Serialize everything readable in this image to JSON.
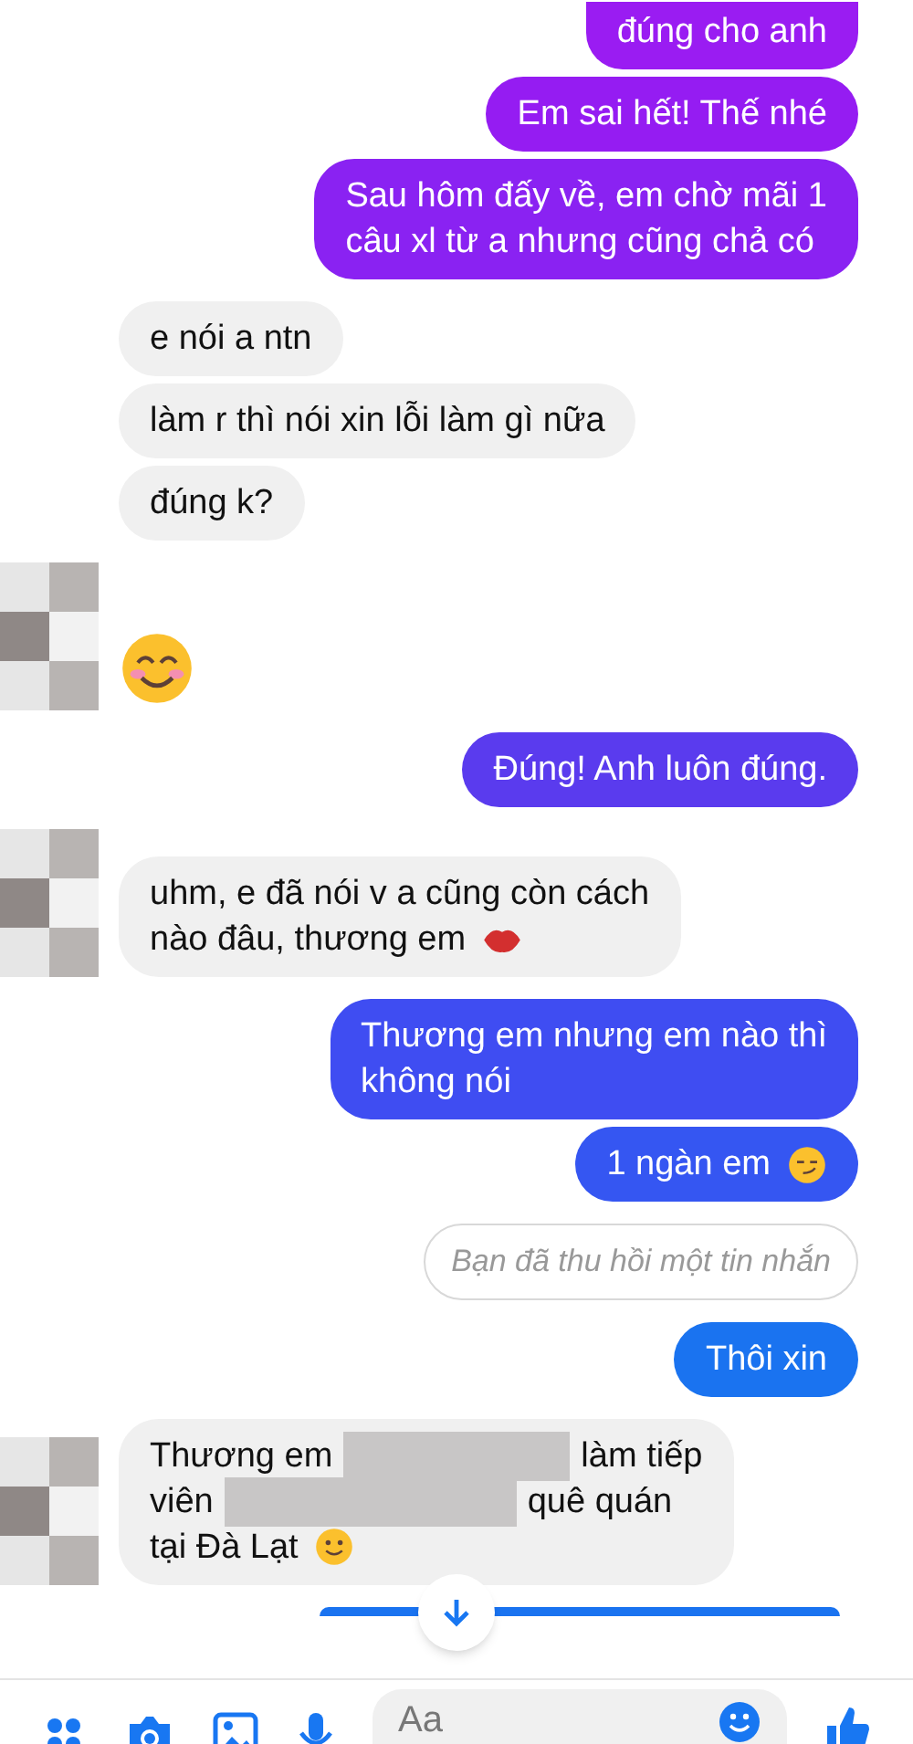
{
  "messages": [
    {
      "kind": "bubble",
      "outgoing": true,
      "color": "#9a1cf2",
      "cut_top": true,
      "avatar": false,
      "lines": [
        [
          {
            "kind": "text",
            "text": "đúng cho anh"
          }
        ]
      ]
    },
    {
      "kind": "bubble",
      "outgoing": true,
      "color": "#951cf2",
      "cut_top": false,
      "avatar": false,
      "lines": [
        [
          {
            "kind": "text",
            "text": "Em sai hết! Thế nhé"
          }
        ]
      ]
    },
    {
      "kind": "bubble",
      "outgoing": true,
      "color": "#8a22f2",
      "cut_top": false,
      "avatar": false,
      "lines": [
        [
          {
            "kind": "text",
            "text": "Sau hôm đấy về, em chờ mãi 1"
          }
        ],
        [
          {
            "kind": "text",
            "text": "câu xl từ a nhưng cũng chả có"
          }
        ]
      ]
    },
    {
      "kind": "bubble",
      "outgoing": false,
      "color": "#f0f0f0",
      "cut_top": false,
      "avatar": false,
      "lines": [
        [
          {
            "kind": "text",
            "text": "e nói a ntn"
          }
        ]
      ]
    },
    {
      "kind": "bubble",
      "outgoing": false,
      "color": "#f0f0f0",
      "cut_top": false,
      "avatar": false,
      "lines": [
        [
          {
            "kind": "text",
            "text": "làm r thì nói xin lỗi làm gì nữa"
          }
        ]
      ]
    },
    {
      "kind": "bubble",
      "outgoing": false,
      "color": "#f0f0f0",
      "cut_top": false,
      "avatar": false,
      "lines": [
        [
          {
            "kind": "text",
            "text": "đúng k?"
          }
        ]
      ]
    },
    {
      "kind": "emoji",
      "outgoing": false,
      "avatar": true,
      "lines": [
        [
          {
            "kind": "blush"
          }
        ]
      ]
    },
    {
      "kind": "bubble",
      "outgoing": true,
      "color": "#5a3bee",
      "cut_top": false,
      "avatar": false,
      "lines": [
        [
          {
            "kind": "text",
            "text": "Đúng! Anh luôn đúng."
          }
        ]
      ]
    },
    {
      "kind": "bubble",
      "outgoing": false,
      "color": "#f0f0f0",
      "cut_top": false,
      "avatar": true,
      "lines": [
        [
          {
            "kind": "text",
            "text": "uhm, e đã nói v a cũng còn cách"
          }
        ],
        [
          {
            "kind": "text",
            "text": "nào đâu, thương em"
          },
          {
            "kind": "kiss"
          }
        ]
      ]
    },
    {
      "kind": "bubble",
      "outgoing": true,
      "color": "#3f4df2",
      "cut_top": false,
      "avatar": false,
      "lines": [
        [
          {
            "kind": "text",
            "text": "Thương em nhưng em nào thì"
          }
        ],
        [
          {
            "kind": "text",
            "text": "không nói"
          }
        ]
      ]
    },
    {
      "kind": "bubble",
      "outgoing": true,
      "color": "#3556f2",
      "cut_top": false,
      "avatar": false,
      "lines": [
        [
          {
            "kind": "text",
            "text": "1 ngàn em"
          },
          {
            "kind": "smirk"
          }
        ]
      ]
    },
    {
      "kind": "recalled",
      "outgoing": true,
      "color": "#ffffff",
      "avatar": false,
      "lines": [
        [
          {
            "kind": "text",
            "text": "Bạn đã thu hồi một tin nhắn"
          }
        ]
      ]
    },
    {
      "kind": "bubble",
      "outgoing": true,
      "color": "#1a73f0",
      "cut_top": false,
      "avatar": false,
      "lines": [
        [
          {
            "kind": "text",
            "text": "Thôi xin"
          }
        ]
      ]
    },
    {
      "kind": "bubble",
      "outgoing": false,
      "color": "#f0f0f0",
      "cut_top": false,
      "avatar": true,
      "lines": [
        [
          {
            "kind": "text",
            "text": "Thương em"
          },
          {
            "kind": "censor"
          },
          {
            "kind": "text",
            "text": "làm tiếp"
          }
        ],
        [
          {
            "kind": "text",
            "text": "viên"
          },
          {
            "kind": "censor"
          },
          {
            "kind": "text",
            "text": "quê quán"
          }
        ],
        [
          {
            "kind": "text",
            "text": "tại Đà Lạt"
          },
          {
            "kind": "smile"
          }
        ]
      ]
    }
  ],
  "partial_bubble": {
    "color": "#1a73f0"
  },
  "composer": {
    "placeholder": "Aa"
  }
}
